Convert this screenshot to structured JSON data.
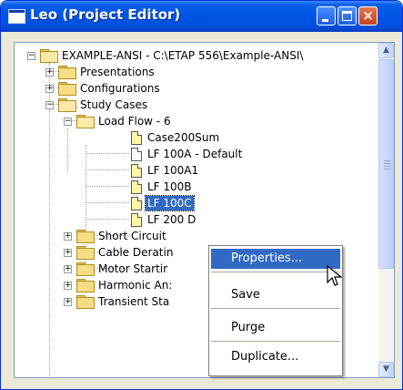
{
  "window": {
    "title": "Leo (Project Editor)",
    "controls": {
      "minimize": "minimize-icon",
      "maximize": "maximize-icon",
      "close": "×"
    }
  },
  "tree": {
    "root": "EXAMPLE-ANSI - C:\\ETAP 556\\Example-ANSI\\",
    "presentations": "Presentations",
    "configurations": "Configurations",
    "study_cases": "Study Cases",
    "load_flow": "Load Flow - 6",
    "lf_items": [
      "Case200Sum",
      "LF 100A - Default",
      "LF 100A1",
      "LF 100B",
      "LF 100C",
      "LF 200 D"
    ],
    "other_studies": [
      "Short Circuit",
      "Cable Deratin",
      "Motor Startir",
      "Harmonic An:",
      "Transient Sta"
    ],
    "selected_item": "LF 100C"
  },
  "context_menu": {
    "items": [
      "Properties...",
      "Save",
      "Purge",
      "Duplicate..."
    ],
    "highlighted": "Properties..."
  },
  "scrollbar": {
    "up_arrow": "▲",
    "down_arrow": "▼"
  },
  "colors": {
    "titlebar": "#0055e6",
    "selection": "#316ac5",
    "close_button": "#c8401d",
    "folder": "#f6dc83"
  }
}
